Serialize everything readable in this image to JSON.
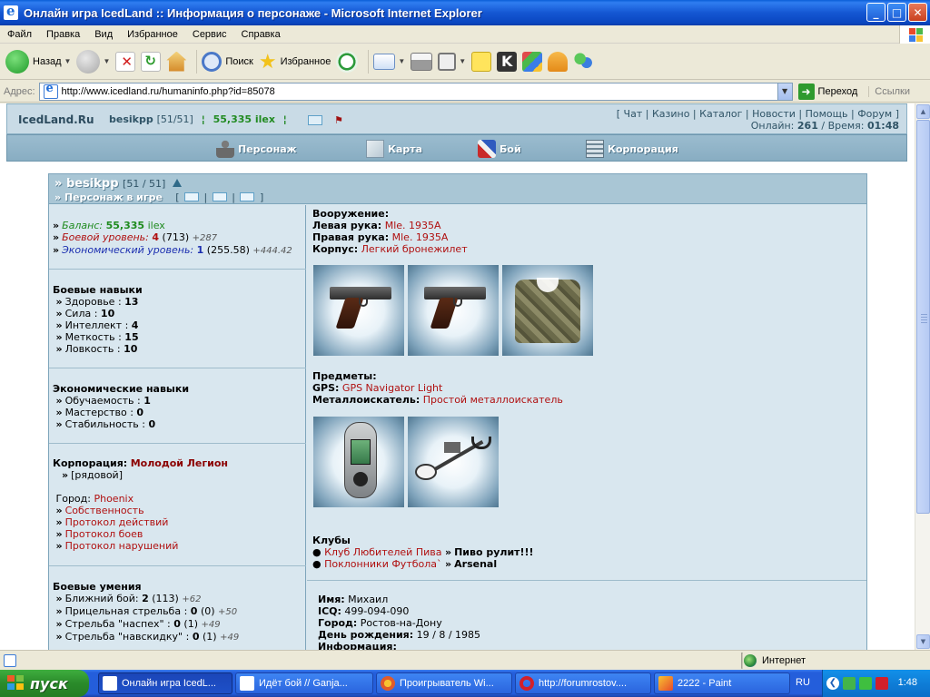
{
  "window": {
    "title": "Онлайн игра IcedLand :: Информация о персонаже - Microsoft Internet Explorer",
    "buttons": [
      "_",
      "□",
      "✕"
    ]
  },
  "menu": [
    "Файл",
    "Правка",
    "Вид",
    "Избранное",
    "Сервис",
    "Справка"
  ],
  "toolbar": {
    "back": "Назад",
    "search": "Поиск",
    "favorites": "Избранное"
  },
  "address": {
    "label": "Адрес:",
    "url": "http://www.icedland.ru/humaninfo.php?id=85078",
    "go": "Переход",
    "links": "Ссылки"
  },
  "site": {
    "logo": "IcedLand.Ru",
    "user_name": "besikpp",
    "user_level": "[51/51]",
    "money": "55,335 ilex",
    "links": [
      "Чат",
      "Казино",
      "Каталог",
      "Новости",
      "Помощь",
      "Форум"
    ],
    "online_label": "Онлайн:",
    "online_value": "261",
    "time_label": "Время:",
    "time_value": "01:48",
    "nav": [
      "Персонаж",
      "Карта",
      "Бой",
      "Корпорация"
    ]
  },
  "profile": {
    "name": "besikpp",
    "level": "[51 / 51]",
    "status": "Персонаж в игре",
    "balance_label": "Баланс:",
    "balance_value": "55,335",
    "balance_unit": "ilex",
    "combat_label": "Боевой уровень:",
    "combat_value": "4",
    "combat_exp": "(713)",
    "combat_plus": "+287",
    "econ_label": "Экономический уровень:",
    "econ_value": "1",
    "econ_exp": "(255.58)",
    "econ_plus": "+444.42",
    "combat_skills_title": "Боевые навыки",
    "combat_skills": [
      {
        "name": "Здоровье",
        "value": "13"
      },
      {
        "name": "Сила",
        "value": "10"
      },
      {
        "name": "Интеллект",
        "value": "4"
      },
      {
        "name": "Меткость",
        "value": "15"
      },
      {
        "name": "Ловкость",
        "value": "10"
      }
    ],
    "econ_skills_title": "Экономические навыки",
    "econ_skills": [
      {
        "name": "Обучаемость",
        "value": "1"
      },
      {
        "name": "Мастерство",
        "value": "0"
      },
      {
        "name": "Стабильность",
        "value": "0"
      }
    ],
    "corp_label": "Корпорация:",
    "corp_name": "Молодой Легион",
    "corp_rank": "[рядовой]",
    "city_label": "Город:",
    "city": "Phoenix",
    "links": [
      "Собственность",
      "Протокол действий",
      "Протокол боев",
      "Протокол нарушений"
    ],
    "abilities_title": "Боевые умения",
    "abilities": [
      {
        "name": "Ближний бой",
        "value": "2",
        "exp": "(113)",
        "plus": "+62"
      },
      {
        "name": "Прицельная стрельба",
        "value": "0",
        "exp": "(0)",
        "plus": "+50"
      },
      {
        "name": "Стрельба \"наспех\"",
        "value": "0",
        "exp": "(1)",
        "plus": "+49"
      },
      {
        "name": "Стрельба \"навскидку\"",
        "value": "0",
        "exp": "(1)",
        "plus": "+49"
      }
    ]
  },
  "equipment": {
    "weapons_title": "Вооружение:",
    "left_label": "Левая рука:",
    "left_value": "Mle. 1935A",
    "right_label": "Правая рука:",
    "right_value": "Mle. 1935A",
    "body_label": "Корпус:",
    "body_value": "Легкий бронежилет",
    "items_title": "Предметы:",
    "gps_label": "GPS:",
    "gps_value": "GPS Navigator Light",
    "detector_label": "Металлоискатель:",
    "detector_value": "Простой металлоискатель",
    "clubs_title": "Клубы",
    "clubs": [
      {
        "name": "Клуб Любителей Пива",
        "motto": "Пиво рулит!!!"
      },
      {
        "name": "Поклонники Футбола`",
        "motto": "Arsenal"
      }
    ],
    "info": [
      {
        "label": "Имя:",
        "value": "Михаил"
      },
      {
        "label": "ICQ:",
        "value": "499-094-090"
      },
      {
        "label": "Город:",
        "value": "Ростов-на-Дону"
      },
      {
        "label": "День рождения:",
        "value": "19 / 8 / 1985"
      }
    ],
    "info_cut": "Информация:"
  },
  "statusbar": {
    "zone": "Интернет"
  },
  "taskbar": {
    "start": "пуск",
    "tasks": [
      "Онлайн игра IcedL...",
      "Идёт бой // Ganja...",
      "Проигрыватель Wi...",
      "http://forumrostov....",
      "2222 - Paint"
    ],
    "lang": "RU",
    "clock": "1:48"
  }
}
